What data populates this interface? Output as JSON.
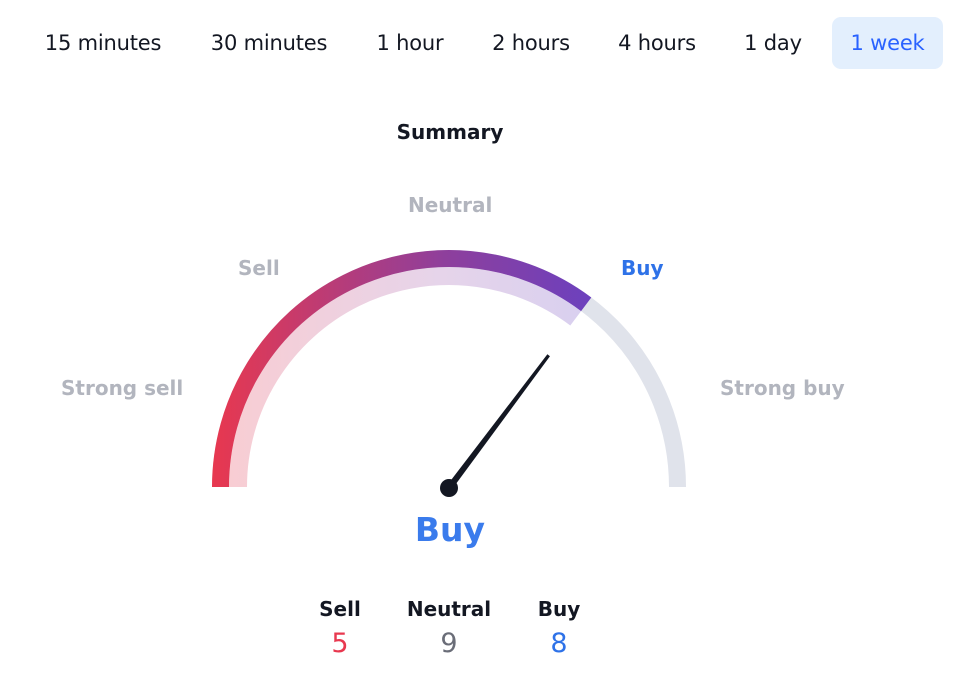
{
  "timeframes": {
    "items": [
      {
        "label": "15 minutes",
        "active": false
      },
      {
        "label": "30 minutes",
        "active": false
      },
      {
        "label": "1 hour",
        "active": false
      },
      {
        "label": "2 hours",
        "active": false
      },
      {
        "label": "4 hours",
        "active": false
      },
      {
        "label": "1 day",
        "active": false
      },
      {
        "label": "1 week",
        "active": true
      }
    ]
  },
  "summary": {
    "title": "Summary",
    "gauge": {
      "labels": {
        "strong_sell": "Strong sell",
        "sell": "Sell",
        "neutral": "Neutral",
        "buy": "Buy",
        "strong_buy": "Strong buy"
      },
      "active_label": "buy",
      "value_fraction": 0.705,
      "colors": {
        "gradient_start": "#e8384f",
        "gradient_mid": "#8e3f9c",
        "gradient_end": "#6a41c0",
        "inner_start": "#f8cdd3",
        "inner_mid": "#e6d4ea",
        "inner_end": "#d9d0ef",
        "track": "#e0e3eb",
        "needle": "#131722"
      }
    },
    "verdict": "Buy",
    "counts": {
      "sell": {
        "label": "Sell",
        "value": "5",
        "color": "#e8384f"
      },
      "neutral": {
        "label": "Neutral",
        "value": "9",
        "color": "#6a6d78"
      },
      "buy": {
        "label": "Buy",
        "value": "8",
        "color": "#2e72e8"
      }
    }
  }
}
